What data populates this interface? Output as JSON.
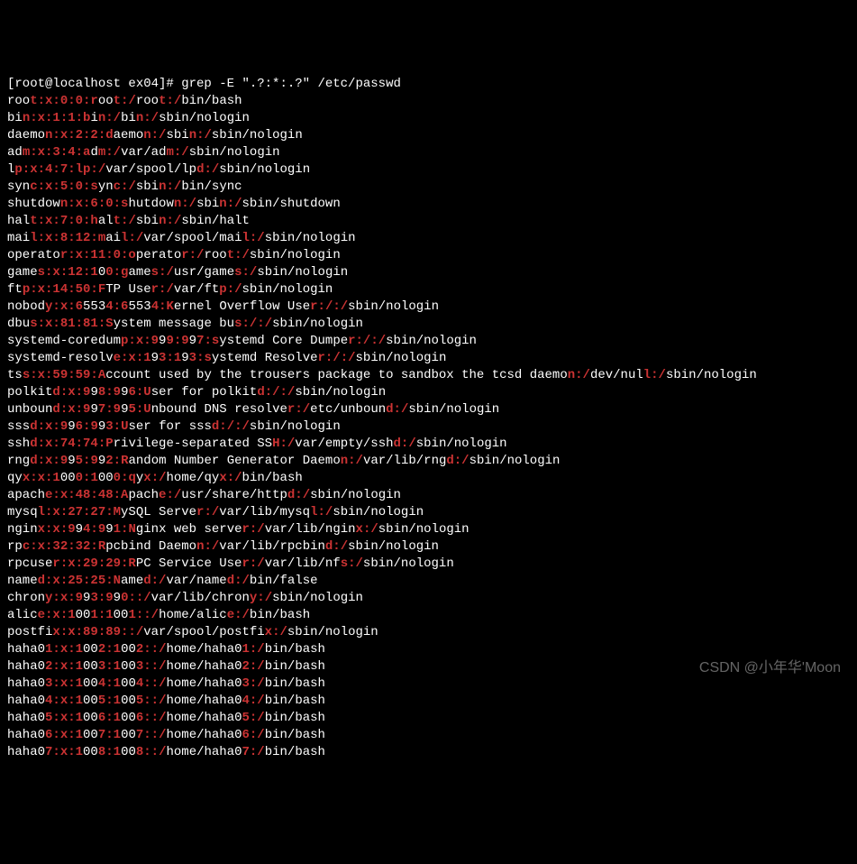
{
  "prompt": "[root@localhost ex04]# grep -E \".?:*:.?\" /etc/passwd",
  "watermark": "CSDN @小年华'Moon",
  "lines": [
    [
      [
        "roo",
        0
      ],
      [
        "t:x:0:0:r",
        1
      ],
      [
        "oo",
        0
      ],
      [
        "t:/",
        1
      ],
      [
        "roo",
        0
      ],
      [
        "t:/",
        1
      ],
      [
        "bin/bash",
        0
      ]
    ],
    [
      [
        "bi",
        0
      ],
      [
        "n:x:1:1:b",
        1
      ],
      [
        "i",
        0
      ],
      [
        "n:/",
        1
      ],
      [
        "bi",
        0
      ],
      [
        "n:/",
        1
      ],
      [
        "sbin/nologin",
        0
      ]
    ],
    [
      [
        "daemo",
        0
      ],
      [
        "n:x:2:2:d",
        1
      ],
      [
        "aemo",
        0
      ],
      [
        "n:/",
        1
      ],
      [
        "sbi",
        0
      ],
      [
        "n:/",
        1
      ],
      [
        "sbin/nologin",
        0
      ]
    ],
    [
      [
        "ad",
        0
      ],
      [
        "m:x:3:4:a",
        1
      ],
      [
        "d",
        0
      ],
      [
        "m:/",
        1
      ],
      [
        "var/ad",
        0
      ],
      [
        "m:/",
        1
      ],
      [
        "sbin/nologin",
        0
      ]
    ],
    [
      [
        "l",
        0
      ],
      [
        "p:x:4:7:lp:/",
        1
      ],
      [
        "var/spool/lp",
        0
      ],
      [
        "d:/",
        1
      ],
      [
        "sbin/nologin",
        0
      ]
    ],
    [
      [
        "syn",
        0
      ],
      [
        "c:x:5:0:s",
        1
      ],
      [
        "yn",
        0
      ],
      [
        "c:/",
        1
      ],
      [
        "sbi",
        0
      ],
      [
        "n:/",
        1
      ],
      [
        "bin/sync",
        0
      ]
    ],
    [
      [
        "shutdow",
        0
      ],
      [
        "n:x:6:0:s",
        1
      ],
      [
        "hutdow",
        0
      ],
      [
        "n:/",
        1
      ],
      [
        "sbi",
        0
      ],
      [
        "n:/",
        1
      ],
      [
        "sbin/shutdown",
        0
      ]
    ],
    [
      [
        "hal",
        0
      ],
      [
        "t:x:7:0:h",
        1
      ],
      [
        "al",
        0
      ],
      [
        "t:/",
        1
      ],
      [
        "sbi",
        0
      ],
      [
        "n:/",
        1
      ],
      [
        "sbin/halt",
        0
      ]
    ],
    [
      [
        "mai",
        0
      ],
      [
        "l:x:8:12:m",
        1
      ],
      [
        "ai",
        0
      ],
      [
        "l:/",
        1
      ],
      [
        "var/spool/mai",
        0
      ],
      [
        "l:/",
        1
      ],
      [
        "sbin/nologin",
        0
      ]
    ],
    [
      [
        "operato",
        0
      ],
      [
        "r:x:11:0:o",
        1
      ],
      [
        "perato",
        0
      ],
      [
        "r:/",
        1
      ],
      [
        "roo",
        0
      ],
      [
        "t:/",
        1
      ],
      [
        "sbin/nologin",
        0
      ]
    ],
    [
      [
        "game",
        0
      ],
      [
        "s:x:12:1",
        1
      ],
      [
        "0",
        0
      ],
      [
        "0:g",
        1
      ],
      [
        "ame",
        0
      ],
      [
        "s:/",
        1
      ],
      [
        "usr/game",
        0
      ],
      [
        "s:/",
        1
      ],
      [
        "sbin/nologin",
        0
      ]
    ],
    [
      [
        "ft",
        0
      ],
      [
        "p:x:14:50:F",
        1
      ],
      [
        "TP Use",
        0
      ],
      [
        "r:/",
        1
      ],
      [
        "var/ft",
        0
      ],
      [
        "p:/",
        1
      ],
      [
        "sbin/nologin",
        0
      ]
    ],
    [
      [
        "nobod",
        0
      ],
      [
        "y:x:6",
        1
      ],
      [
        "553",
        0
      ],
      [
        "4:6",
        1
      ],
      [
        "553",
        0
      ],
      [
        "4:K",
        1
      ],
      [
        "ernel Overflow Use",
        0
      ],
      [
        "r:/:/",
        1
      ],
      [
        "sbin/nologin",
        0
      ]
    ],
    [
      [
        "dbu",
        0
      ],
      [
        "s:x:81:81:S",
        1
      ],
      [
        "ystem message bu",
        0
      ],
      [
        "s:/:/",
        1
      ],
      [
        "sbin/nologin",
        0
      ]
    ],
    [
      [
        "systemd-coredum",
        0
      ],
      [
        "p:x:9",
        1
      ],
      [
        "9",
        0
      ],
      [
        "9:9",
        1
      ],
      [
        "9",
        0
      ],
      [
        "7:s",
        1
      ],
      [
        "ystemd Core Dumpe",
        0
      ],
      [
        "r:/:/",
        1
      ],
      [
        "sbin/nologin",
        0
      ]
    ],
    [
      [
        "systemd-resolv",
        0
      ],
      [
        "e:x:1",
        1
      ],
      [
        "9",
        0
      ],
      [
        "3:1",
        1
      ],
      [
        "9",
        0
      ],
      [
        "3:s",
        1
      ],
      [
        "ystemd Resolve",
        0
      ],
      [
        "r:/:/",
        1
      ],
      [
        "sbin/nologin",
        0
      ]
    ],
    [
      [
        "ts",
        0
      ],
      [
        "s:x:59:59:A",
        1
      ],
      [
        "ccount used by the trousers package to sandbox the tcsd daemo",
        0
      ],
      [
        "n:/",
        1
      ],
      [
        "dev/nul",
        0
      ],
      [
        "l:/",
        1
      ],
      [
        "sbin/nologin",
        0
      ]
    ],
    [
      [
        "polkit",
        0
      ],
      [
        "d:x:9",
        1
      ],
      [
        "9",
        0
      ],
      [
        "8:9",
        1
      ],
      [
        "9",
        0
      ],
      [
        "6:U",
        1
      ],
      [
        "ser for polkit",
        0
      ],
      [
        "d:/:/",
        1
      ],
      [
        "sbin/nologin",
        0
      ]
    ],
    [
      [
        "unboun",
        0
      ],
      [
        "d:x:9",
        1
      ],
      [
        "9",
        0
      ],
      [
        "7:9",
        1
      ],
      [
        "9",
        0
      ],
      [
        "5:U",
        1
      ],
      [
        "nbound DNS resolve",
        0
      ],
      [
        "r:/",
        1
      ],
      [
        "etc/unboun",
        0
      ],
      [
        "d:/",
        1
      ],
      [
        "sbin/nologin",
        0
      ]
    ],
    [
      [
        "sss",
        0
      ],
      [
        "d:x:9",
        1
      ],
      [
        "9",
        0
      ],
      [
        "6:9",
        1
      ],
      [
        "9",
        0
      ],
      [
        "3:U",
        1
      ],
      [
        "ser for sss",
        0
      ],
      [
        "d:/:/",
        1
      ],
      [
        "sbin/nologin",
        0
      ]
    ],
    [
      [
        "ssh",
        0
      ],
      [
        "d:x:74:74:P",
        1
      ],
      [
        "rivilege-separated SS",
        0
      ],
      [
        "H:/",
        1
      ],
      [
        "var/empty/ssh",
        0
      ],
      [
        "d:/",
        1
      ],
      [
        "sbin/nologin",
        0
      ]
    ],
    [
      [
        "rng",
        0
      ],
      [
        "d:x:9",
        1
      ],
      [
        "9",
        0
      ],
      [
        "5:9",
        1
      ],
      [
        "9",
        0
      ],
      [
        "2:R",
        1
      ],
      [
        "andom Number Generator Daemo",
        0
      ],
      [
        "n:/",
        1
      ],
      [
        "var/lib/rng",
        0
      ],
      [
        "d:/",
        1
      ],
      [
        "sbin/nologin",
        0
      ]
    ],
    [
      [
        "qy",
        0
      ],
      [
        "x:x:1",
        1
      ],
      [
        "00",
        0
      ],
      [
        "0:1",
        1
      ],
      [
        "00",
        0
      ],
      [
        "0:q",
        1
      ],
      [
        "y",
        0
      ],
      [
        "x:/",
        1
      ],
      [
        "home/qy",
        0
      ],
      [
        "x:/",
        1
      ],
      [
        "bin/bash",
        0
      ]
    ],
    [
      [
        "apach",
        0
      ],
      [
        "e:x:48:48:A",
        1
      ],
      [
        "pach",
        0
      ],
      [
        "e:/",
        1
      ],
      [
        "usr/share/http",
        0
      ],
      [
        "d:/",
        1
      ],
      [
        "sbin/nologin",
        0
      ]
    ],
    [
      [
        "mysq",
        0
      ],
      [
        "l:x:27:27:M",
        1
      ],
      [
        "ySQL Serve",
        0
      ],
      [
        "r:/",
        1
      ],
      [
        "var/lib/mysq",
        0
      ],
      [
        "l:/",
        1
      ],
      [
        "sbin/nologin",
        0
      ]
    ],
    [
      [
        "ngin",
        0
      ],
      [
        "x:x:9",
        1
      ],
      [
        "9",
        0
      ],
      [
        "4:9",
        1
      ],
      [
        "9",
        0
      ],
      [
        "1:N",
        1
      ],
      [
        "ginx web serve",
        0
      ],
      [
        "r:/",
        1
      ],
      [
        "var/lib/ngin",
        0
      ],
      [
        "x:/",
        1
      ],
      [
        "sbin/nologin",
        0
      ]
    ],
    [
      [
        "rp",
        0
      ],
      [
        "c:x:32:32:R",
        1
      ],
      [
        "pcbind Daemo",
        0
      ],
      [
        "n:/",
        1
      ],
      [
        "var/lib/rpcbin",
        0
      ],
      [
        "d:/",
        1
      ],
      [
        "sbin/nologin",
        0
      ]
    ],
    [
      [
        "rpcuse",
        0
      ],
      [
        "r:x:29:29:R",
        1
      ],
      [
        "PC Service Use",
        0
      ],
      [
        "r:/",
        1
      ],
      [
        "var/lib/nf",
        0
      ],
      [
        "s:/",
        1
      ],
      [
        "sbin/nologin",
        0
      ]
    ],
    [
      [
        "name",
        0
      ],
      [
        "d:x:25:25:N",
        1
      ],
      [
        "ame",
        0
      ],
      [
        "d:/",
        1
      ],
      [
        "var/name",
        0
      ],
      [
        "d:/",
        1
      ],
      [
        "bin/false",
        0
      ]
    ],
    [
      [
        "chron",
        0
      ],
      [
        "y:x:9",
        1
      ],
      [
        "9",
        0
      ],
      [
        "3:9",
        1
      ],
      [
        "9",
        0
      ],
      [
        "0::/",
        1
      ],
      [
        "var/lib/chron",
        0
      ],
      [
        "y:/",
        1
      ],
      [
        "sbin/nologin",
        0
      ]
    ],
    [
      [
        "alic",
        0
      ],
      [
        "e:x:1",
        1
      ],
      [
        "00",
        0
      ],
      [
        "1:1",
        1
      ],
      [
        "00",
        0
      ],
      [
        "1::/",
        1
      ],
      [
        "home/alic",
        0
      ],
      [
        "e:/",
        1
      ],
      [
        "bin/bash",
        0
      ]
    ],
    [
      [
        "postfi",
        0
      ],
      [
        "x:x:89:89::/",
        1
      ],
      [
        "var/spool/postfi",
        0
      ],
      [
        "x:/",
        1
      ],
      [
        "sbin/nologin",
        0
      ]
    ],
    [
      [
        "haha0",
        0
      ],
      [
        "1:x:1",
        1
      ],
      [
        "00",
        0
      ],
      [
        "2:1",
        1
      ],
      [
        "00",
        0
      ],
      [
        "2::/",
        1
      ],
      [
        "home/haha0",
        0
      ],
      [
        "1:/",
        1
      ],
      [
        "bin/bash",
        0
      ]
    ],
    [
      [
        "haha0",
        0
      ],
      [
        "2:x:1",
        1
      ],
      [
        "00",
        0
      ],
      [
        "3:1",
        1
      ],
      [
        "00",
        0
      ],
      [
        "3::/",
        1
      ],
      [
        "home/haha0",
        0
      ],
      [
        "2:/",
        1
      ],
      [
        "bin/bash",
        0
      ]
    ],
    [
      [
        "haha0",
        0
      ],
      [
        "3:x:1",
        1
      ],
      [
        "00",
        0
      ],
      [
        "4:1",
        1
      ],
      [
        "00",
        0
      ],
      [
        "4::/",
        1
      ],
      [
        "home/haha0",
        0
      ],
      [
        "3:/",
        1
      ],
      [
        "bin/bash",
        0
      ]
    ],
    [
      [
        "haha0",
        0
      ],
      [
        "4:x:1",
        1
      ],
      [
        "00",
        0
      ],
      [
        "5:1",
        1
      ],
      [
        "00",
        0
      ],
      [
        "5::/",
        1
      ],
      [
        "home/haha0",
        0
      ],
      [
        "4:/",
        1
      ],
      [
        "bin/bash",
        0
      ]
    ],
    [
      [
        "haha0",
        0
      ],
      [
        "5:x:1",
        1
      ],
      [
        "00",
        0
      ],
      [
        "6:1",
        1
      ],
      [
        "00",
        0
      ],
      [
        "6::/",
        1
      ],
      [
        "home/haha0",
        0
      ],
      [
        "5:/",
        1
      ],
      [
        "bin/bash",
        0
      ]
    ],
    [
      [
        "haha0",
        0
      ],
      [
        "6:x:1",
        1
      ],
      [
        "00",
        0
      ],
      [
        "7:1",
        1
      ],
      [
        "00",
        0
      ],
      [
        "7::/",
        1
      ],
      [
        "home/haha0",
        0
      ],
      [
        "6:/",
        1
      ],
      [
        "bin/bash",
        0
      ]
    ],
    [
      [
        "haha0",
        0
      ],
      [
        "7:x:1",
        1
      ],
      [
        "00",
        0
      ],
      [
        "8:1",
        1
      ],
      [
        "00",
        0
      ],
      [
        "8::/",
        1
      ],
      [
        "home/haha0",
        0
      ],
      [
        "7:/",
        1
      ],
      [
        "bin/bash",
        0
      ]
    ]
  ]
}
